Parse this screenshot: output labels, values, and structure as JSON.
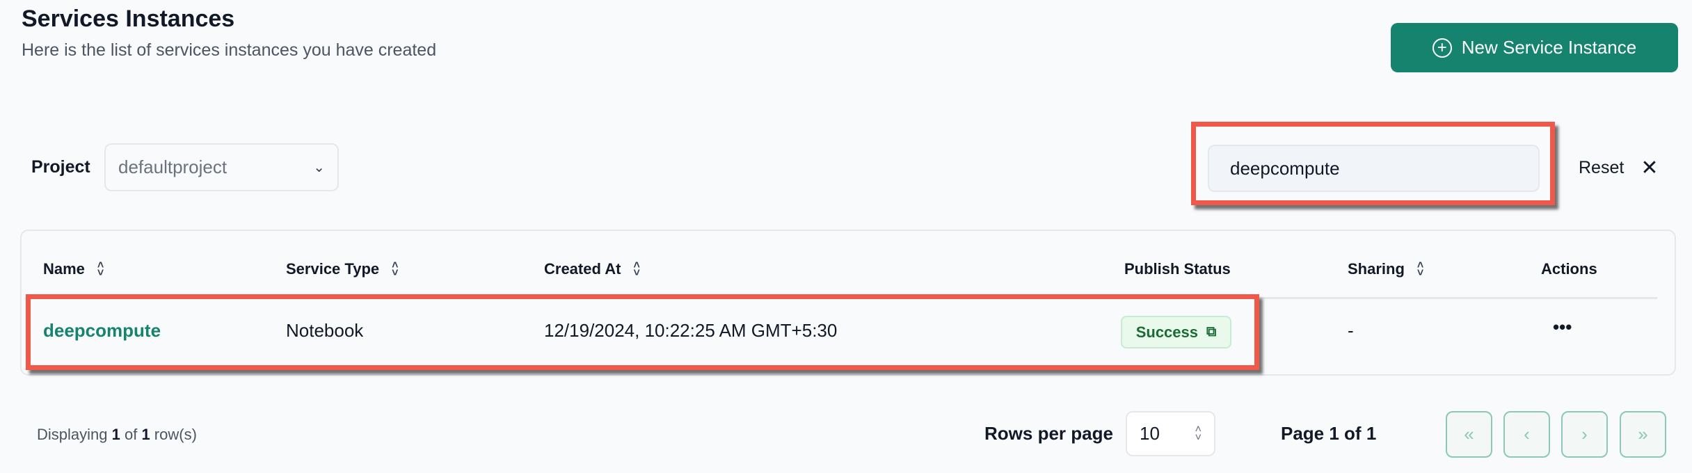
{
  "header": {
    "title": "Services Instances",
    "subtitle": "Here is the list of services instances you have created",
    "new_button": "New Service Instance"
  },
  "filters": {
    "project_label": "Project",
    "project_value": "defaultproject",
    "search_value": "deepcompute",
    "reset_label": "Reset"
  },
  "table": {
    "columns": [
      "Name",
      "Service Type",
      "Created At",
      "Publish Status",
      "Sharing",
      "Actions"
    ],
    "rows": [
      {
        "name": "deepcompute",
        "service_type": "Notebook",
        "created_at": "12/19/2024, 10:22:25 AM GMT+5:30",
        "publish_status": "Success",
        "sharing": "-",
        "actions": "•••"
      }
    ]
  },
  "footer": {
    "displaying_prefix": "Displaying ",
    "shown": "1",
    "of": " of ",
    "total": "1",
    "suffix": " row(s)",
    "rows_per_page_label": "Rows per page",
    "rows_per_page": "10",
    "page_info": "Page 1 of 1"
  },
  "colors": {
    "accent": "#16836f",
    "highlight": "#f0584a",
    "success": "#1b6b34"
  }
}
